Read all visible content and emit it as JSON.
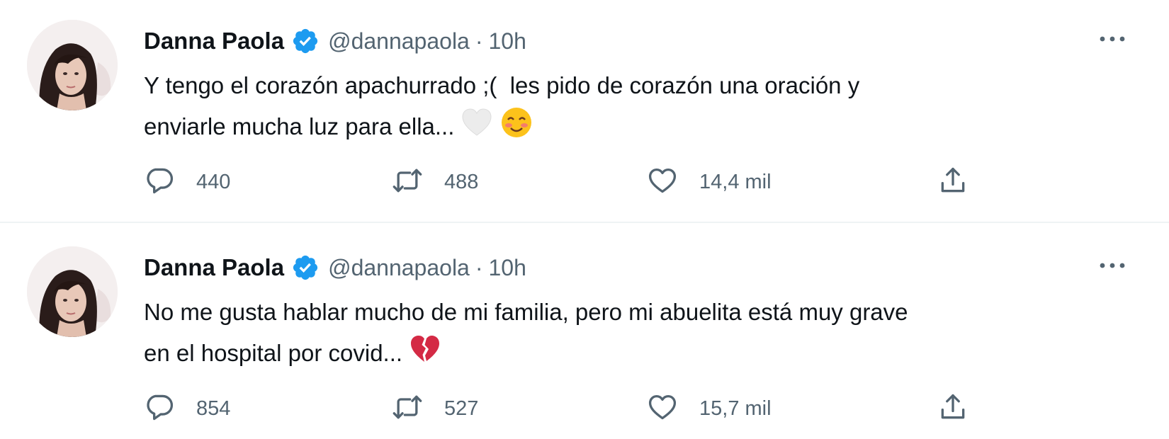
{
  "colors": {
    "text": "#0f1419",
    "secondary": "#536471",
    "verified": "#1d9bf0",
    "divider": "#eff3f4"
  },
  "tweets": [
    {
      "name": "Danna Paola",
      "handle": "@dannapaola",
      "separator": "·",
      "time": "10h",
      "text_lines": [
        "Y tengo el corazón apachurrado ;(  les pido de corazón una oración y",
        "enviarle mucha luz para ella..."
      ],
      "emojis": [
        "white-heart-emoji",
        "smiling-face-with-blush-emoji"
      ],
      "replies": "440",
      "retweets": "488",
      "likes": "14,4 mil"
    },
    {
      "name": "Danna Paola",
      "handle": "@dannapaola",
      "separator": "·",
      "time": "10h",
      "text_lines": [
        "No me gusta hablar mucho de mi familia, pero mi abuelita está muy grave",
        "en el hospital por covid..."
      ],
      "emojis": [
        "broken-heart-emoji"
      ],
      "replies": "854",
      "retweets": "527",
      "likes": "15,7 mil"
    }
  ],
  "icons": [
    "verified-badge-icon",
    "more-icon",
    "reply-icon",
    "retweet-icon",
    "like-icon",
    "share-icon"
  ]
}
